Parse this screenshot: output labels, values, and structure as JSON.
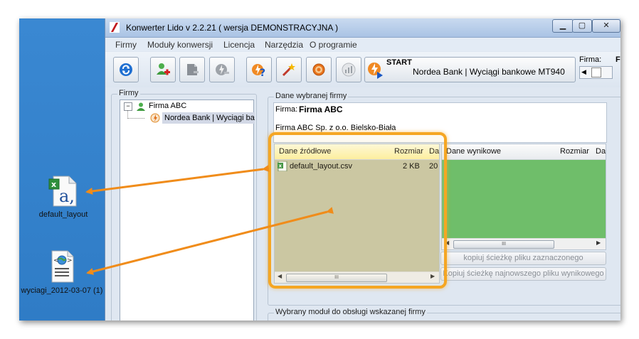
{
  "desktop": {
    "icons": [
      {
        "label": "default_layout",
        "icon": "excel-csv-file-icon"
      },
      {
        "label": "wyciagi_2012-03-07 (1)",
        "icon": "web-document-file-icon"
      }
    ]
  },
  "window": {
    "title": "Konwerter Lido  v 2.2.21 ( wersja DEMONSTRACYJNA )",
    "controls": [
      "minimize",
      "maximize",
      "close"
    ]
  },
  "menu": [
    "Firmy",
    "Moduły konwersji",
    "Licencja",
    "Narzędzia",
    "O programie"
  ],
  "toolbar": {
    "buttons": [
      "refresh-icon",
      "add-company-icon",
      "module-icon",
      "convert-icon",
      "help-icon",
      "wizard-icon",
      "settings-icon",
      "chart-icon"
    ],
    "start_label": "START",
    "start_bank": "Nordea Bank | Wyciągi bankowe MT940",
    "firma_label": "Firma:",
    "firma_cut": "F"
  },
  "tree": {
    "group_label": "Firmy",
    "company": "Firma ABC",
    "module": "Nordea Bank | Wyciągi ba"
  },
  "company_panel": {
    "group_label": "Dane wybranej firmy",
    "firma_prefix": "Firma:",
    "firma_name": "Firma ABC",
    "address": "Firma ABC Sp. z o.o. Bielsko-Biała"
  },
  "source": {
    "columns": [
      "Dane źródłowe",
      "Rozmiar",
      "Da"
    ],
    "rows": [
      {
        "name": "default_layout.csv",
        "size": "2 KB",
        "date": "20"
      }
    ]
  },
  "output": {
    "columns": [
      "Dane wynikowe",
      "Rozmiar",
      "Da"
    ]
  },
  "buttons": {
    "copy_selected": "kopiuj ścieżkę pliku zaznaczonego",
    "copy_newest": "Kopiuj ścieżkę najnowszego pliku wynikowego"
  },
  "module_group_label": "Wybrany moduł do obsługi wskazanej firmy",
  "colors": {
    "desktop": "#3a88d2",
    "highlight": "#f5a623",
    "output_area": "#6fbe6a",
    "source_area": "#c7c5a4",
    "source_header": "#fffbb0"
  }
}
